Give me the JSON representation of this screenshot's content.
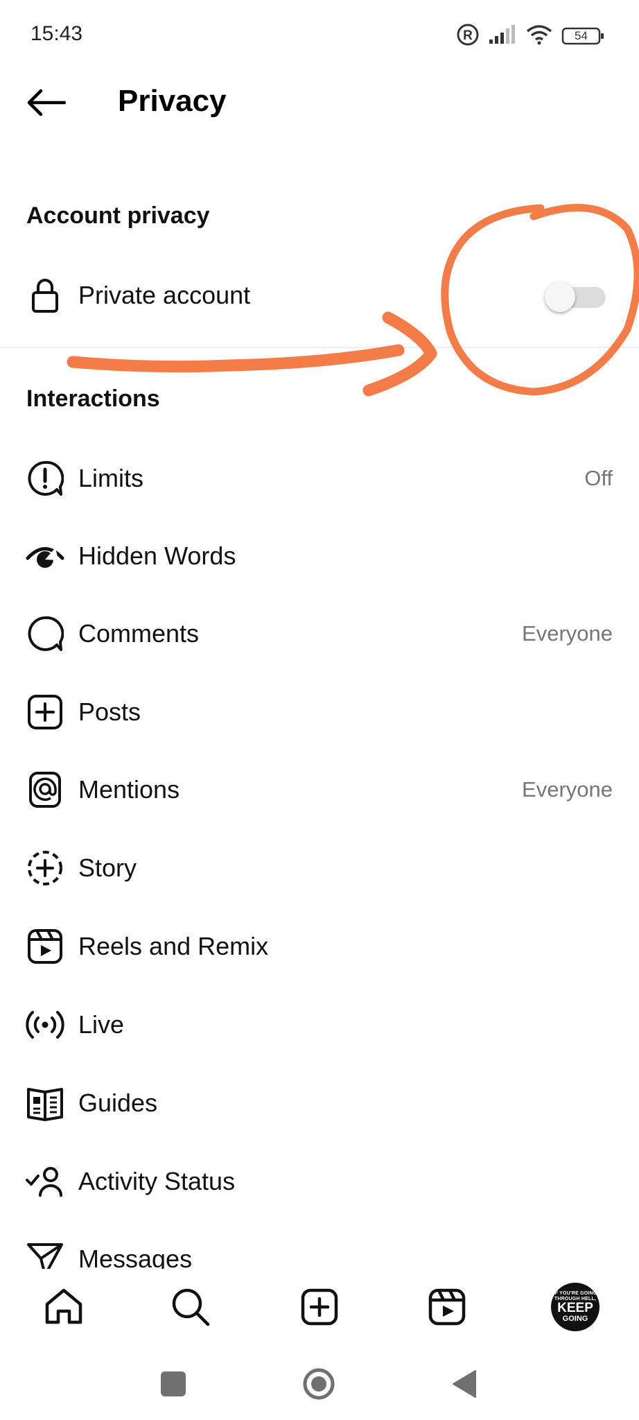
{
  "status_bar": {
    "time": "15:43",
    "battery": "54",
    "icons": [
      "registered-icon",
      "signal-icon",
      "wifi-icon",
      "battery-icon"
    ]
  },
  "header": {
    "title": "Privacy",
    "back_icon": "arrow-left-icon"
  },
  "account_privacy": {
    "heading": "Account privacy",
    "private_account": {
      "label": "Private account",
      "icon": "lock-icon",
      "toggle_on": false
    }
  },
  "interactions": {
    "heading": "Interactions",
    "items": [
      {
        "label": "Limits",
        "value": "Off",
        "icon": "limits-icon"
      },
      {
        "label": "Hidden Words",
        "value": "",
        "icon": "hidden-words-icon"
      },
      {
        "label": "Comments",
        "value": "Everyone",
        "icon": "comment-icon"
      },
      {
        "label": "Posts",
        "value": "",
        "icon": "plus-square-icon"
      },
      {
        "label": "Mentions",
        "value": "Everyone",
        "icon": "at-icon"
      },
      {
        "label": "Story",
        "value": "",
        "icon": "story-add-icon"
      },
      {
        "label": "Reels and Remix",
        "value": "",
        "icon": "reels-icon"
      },
      {
        "label": "Live",
        "value": "",
        "icon": "live-icon"
      },
      {
        "label": "Guides",
        "value": "",
        "icon": "guides-icon"
      },
      {
        "label": "Activity Status",
        "value": "",
        "icon": "activity-status-icon"
      },
      {
        "label": "Messages",
        "value": "",
        "icon": "send-icon"
      }
    ]
  },
  "bottom_nav": {
    "items": [
      "home-icon",
      "search-icon",
      "create-icon",
      "reels-icon",
      "profile-avatar"
    ],
    "avatar_text": {
      "line1": "IF YOU'RE GOING",
      "line2": "THROUGH HELL,",
      "line3": "KEEP",
      "line4": "GOING"
    }
  },
  "system_nav": [
    "recents-icon",
    "home-circle-icon",
    "back-triangle-icon"
  ],
  "colors": {
    "annotation": "#F47C48",
    "secondary_text": "#767676",
    "toggle_track": "#dcdcdc"
  }
}
